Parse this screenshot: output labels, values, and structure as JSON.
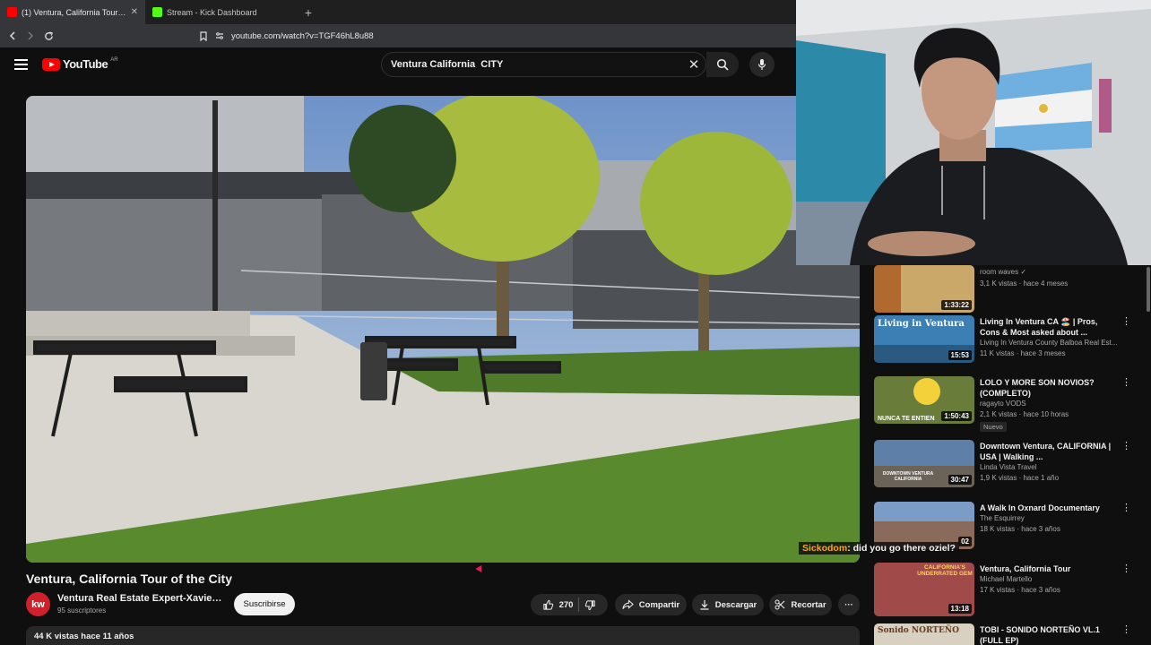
{
  "browser": {
    "tabs": [
      {
        "title": "(1) Ventura, California Tour of",
        "close": "✕",
        "favicon_color": "#ff0000",
        "active": true
      },
      {
        "title": "Stream - Kick Dashboard",
        "favicon_color": "#53fc18",
        "active": false
      }
    ],
    "new_tab": "+",
    "url": "youtube.com/watch?v=TGF46hL8u88"
  },
  "youtube": {
    "logo_text": "YouTube",
    "country_code": "AR",
    "search_query": "Ventura California  CITY",
    "clear": "✕"
  },
  "video": {
    "title": "Ventura, California Tour of the City",
    "channel": {
      "avatar_text": "kw",
      "name": "Ventura Real Estate Expert-Xavier Fl...",
      "subscribers": "95 suscriptores"
    },
    "subscribe_label": "Suscribirse",
    "likes": "270",
    "share_label": "Compartir",
    "download_label": "Descargar",
    "clip_label": "Recortar",
    "more": "···",
    "views_date": "44 K vistas  hace 11 años"
  },
  "recommendations": [
    {
      "title": "",
      "channel": "room waves ✓",
      "meta": "3,1 K vistas · hace 4 meses",
      "duration": "1:33:22",
      "thumb_color": "#c9a86a"
    },
    {
      "title": "Living In Ventura CA 🏖️ | Pros, Cons & Most asked about ...",
      "channel": "Living In Ventura County Balboa Real Est...",
      "meta": "11 K vistas · hace 3 meses",
      "duration": "15:53",
      "thumb_color": "#3b7fb5",
      "thumb_text": "Living in Ventura"
    },
    {
      "title": "LOLO Y MORE SON NOVIOS? (COMPLETO)",
      "channel": "ragayto VODS",
      "meta": "2,1 K vistas · hace 10 horas",
      "badge": "Nuevo",
      "duration": "1:50:43",
      "thumb_color": "#6a7c3a",
      "thumb_text": "NUNCA TE ENTIEN"
    },
    {
      "title": "Downtown Ventura, CALIFORNIA | USA | Walking ...",
      "channel": "Linda Vista Travel",
      "meta": "1,9 K vistas · hace 1 año",
      "duration": "30:47",
      "thumb_color": "#5d7fa8",
      "thumb_text": "DOWNTOWN VENTURA CALIFORNIA"
    },
    {
      "title": "A Walk In Oxnard Documentary",
      "channel": "The Esquirrey",
      "meta": "18 K vistas · hace 3 años",
      "duration": "02",
      "thumb_color": "#8a6a5a"
    },
    {
      "title": "Ventura, California Tour",
      "channel": "Michael Martello",
      "meta": "17 K vistas · hace 3 años",
      "duration": "13:18",
      "thumb_color": "#a04a4a",
      "thumb_text": "CALIFORNIA'S UNDERRATED GEM"
    },
    {
      "title": "TOBI - SONIDO NORTEÑO VL.1 (FULL EP)",
      "channel": "",
      "meta": "",
      "duration": "",
      "thumb_color": "#d8d0c0",
      "thumb_text": "Sonido NORTEÑO"
    }
  ],
  "chat": {
    "user": "Sickodom",
    "separator": ": ",
    "message": "did you go there oziel?"
  },
  "colors": {
    "youtube_red": "#ff0000",
    "background": "#0f0f0f",
    "chat_user": "#f5a623"
  }
}
